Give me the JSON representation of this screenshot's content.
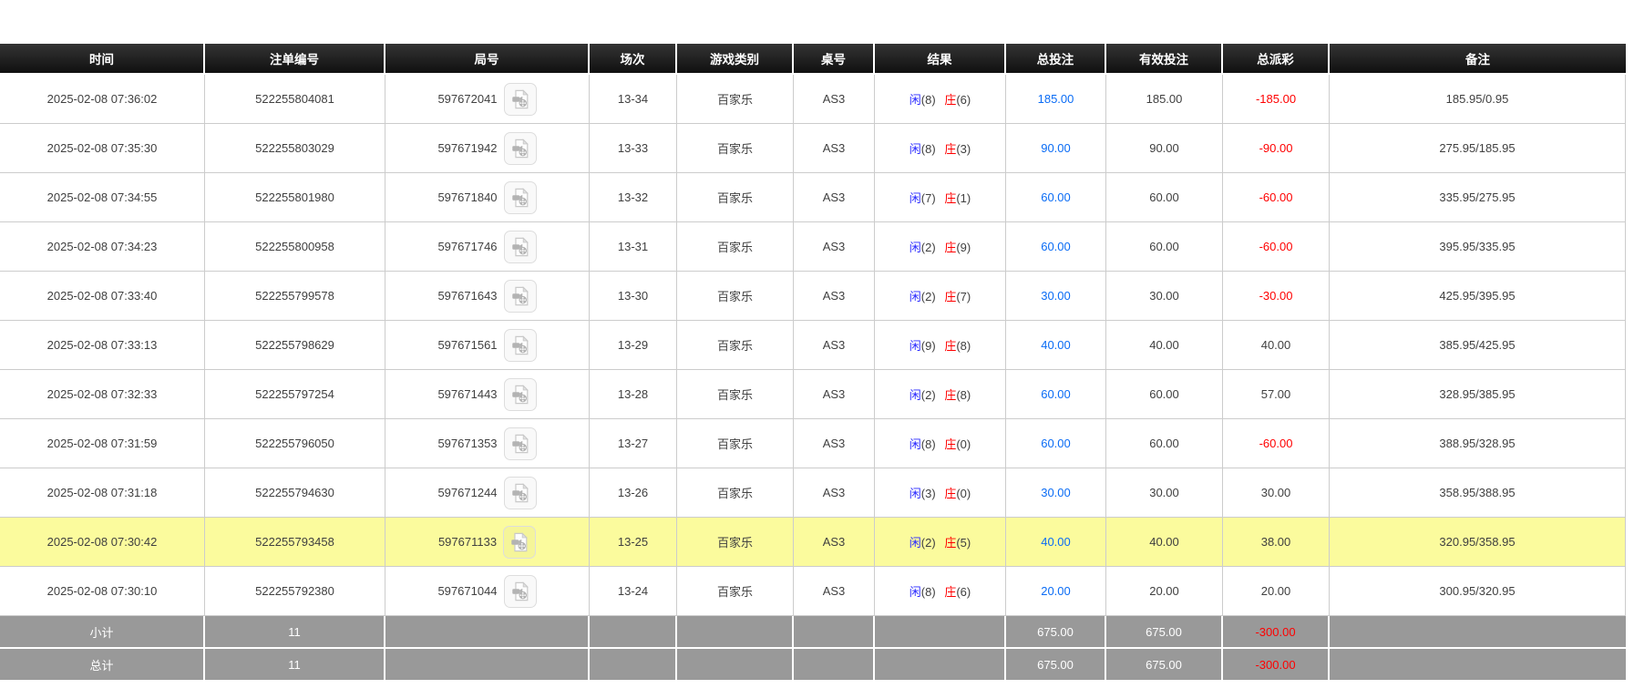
{
  "columns": [
    "时间",
    "注单编号",
    "局号",
    "场次",
    "游戏类别",
    "桌号",
    "结果",
    "总投注",
    "有效投注",
    "总派彩",
    "备注"
  ],
  "highlighted_row_index": 9,
  "colors": {
    "header_bg": "#1b1b1b",
    "footer_bg": "#999999",
    "highlight_row_bg": "#fbfb9d",
    "player_label_color": "#2a2aff",
    "banker_label_color": "#ff0000",
    "total_bet_link_color": "#0a6cf5",
    "negative_value_color": "#ff0000",
    "grid_line_color": "#cccccc"
  },
  "rows": [
    {
      "time": "2025-02-08 07:36:02",
      "bet_id": "522255804081",
      "round_id": "597672041",
      "session": "13-34",
      "game": "百家乐",
      "table": "AS3",
      "result": {
        "player": "闲",
        "player_score": "(8)",
        "banker": "庄",
        "banker_score": "(6)"
      },
      "total_bet": "185.00",
      "valid_bet": "185.00",
      "payout": "-185.00",
      "remark": "185.95/0.95"
    },
    {
      "time": "2025-02-08 07:35:30",
      "bet_id": "522255803029",
      "round_id": "597671942",
      "session": "13-33",
      "game": "百家乐",
      "table": "AS3",
      "result": {
        "player": "闲",
        "player_score": "(8)",
        "banker": "庄",
        "banker_score": "(3)"
      },
      "total_bet": "90.00",
      "valid_bet": "90.00",
      "payout": "-90.00",
      "remark": "275.95/185.95"
    },
    {
      "time": "2025-02-08 07:34:55",
      "bet_id": "522255801980",
      "round_id": "597671840",
      "session": "13-32",
      "game": "百家乐",
      "table": "AS3",
      "result": {
        "player": "闲",
        "player_score": "(7)",
        "banker": "庄",
        "banker_score": "(1)"
      },
      "total_bet": "60.00",
      "valid_bet": "60.00",
      "payout": "-60.00",
      "remark": "335.95/275.95"
    },
    {
      "time": "2025-02-08 07:34:23",
      "bet_id": "522255800958",
      "round_id": "597671746",
      "session": "13-31",
      "game": "百家乐",
      "table": "AS3",
      "result": {
        "player": "闲",
        "player_score": "(2)",
        "banker": "庄",
        "banker_score": "(9)"
      },
      "total_bet": "60.00",
      "valid_bet": "60.00",
      "payout": "-60.00",
      "remark": "395.95/335.95"
    },
    {
      "time": "2025-02-08 07:33:40",
      "bet_id": "522255799578",
      "round_id": "597671643",
      "session": "13-30",
      "game": "百家乐",
      "table": "AS3",
      "result": {
        "player": "闲",
        "player_score": "(2)",
        "banker": "庄",
        "banker_score": "(7)"
      },
      "total_bet": "30.00",
      "valid_bet": "30.00",
      "payout": "-30.00",
      "remark": "425.95/395.95"
    },
    {
      "time": "2025-02-08 07:33:13",
      "bet_id": "522255798629",
      "round_id": "597671561",
      "session": "13-29",
      "game": "百家乐",
      "table": "AS3",
      "result": {
        "player": "闲",
        "player_score": "(9)",
        "banker": "庄",
        "banker_score": "(8)"
      },
      "total_bet": "40.00",
      "valid_bet": "40.00",
      "payout": "40.00",
      "remark": "385.95/425.95"
    },
    {
      "time": "2025-02-08 07:32:33",
      "bet_id": "522255797254",
      "round_id": "597671443",
      "session": "13-28",
      "game": "百家乐",
      "table": "AS3",
      "result": {
        "player": "闲",
        "player_score": "(2)",
        "banker": "庄",
        "banker_score": "(8)"
      },
      "total_bet": "60.00",
      "valid_bet": "60.00",
      "payout": "57.00",
      "remark": "328.95/385.95"
    },
    {
      "time": "2025-02-08 07:31:59",
      "bet_id": "522255796050",
      "round_id": "597671353",
      "session": "13-27",
      "game": "百家乐",
      "table": "AS3",
      "result": {
        "player": "闲",
        "player_score": "(8)",
        "banker": "庄",
        "banker_score": "(0)"
      },
      "total_bet": "60.00",
      "valid_bet": "60.00",
      "payout": "-60.00",
      "remark": "388.95/328.95"
    },
    {
      "time": "2025-02-08 07:31:18",
      "bet_id": "522255794630",
      "round_id": "597671244",
      "session": "13-26",
      "game": "百家乐",
      "table": "AS3",
      "result": {
        "player": "闲",
        "player_score": "(3)",
        "banker": "庄",
        "banker_score": "(0)"
      },
      "total_bet": "30.00",
      "valid_bet": "30.00",
      "payout": "30.00",
      "remark": "358.95/388.95"
    },
    {
      "time": "2025-02-08 07:30:42",
      "bet_id": "522255793458",
      "round_id": "597671133",
      "session": "13-25",
      "game": "百家乐",
      "table": "AS3",
      "result": {
        "player": "闲",
        "player_score": "(2)",
        "banker": "庄",
        "banker_score": "(5)"
      },
      "total_bet": "40.00",
      "valid_bet": "40.00",
      "payout": "38.00",
      "remark": "320.95/358.95"
    },
    {
      "time": "2025-02-08 07:30:10",
      "bet_id": "522255792380",
      "round_id": "597671044",
      "session": "13-24",
      "game": "百家乐",
      "table": "AS3",
      "result": {
        "player": "闲",
        "player_score": "(8)",
        "banker": "庄",
        "banker_score": "(6)"
      },
      "total_bet": "20.00",
      "valid_bet": "20.00",
      "payout": "20.00",
      "remark": "300.95/320.95"
    }
  ],
  "footer": {
    "subtotal": {
      "label": "小计",
      "count": "11",
      "total_bet": "675.00",
      "valid_bet": "675.00",
      "payout": "-300.00"
    },
    "total": {
      "label": "总计",
      "count": "11",
      "total_bet": "675.00",
      "valid_bet": "675.00",
      "payout": "-300.00"
    }
  }
}
